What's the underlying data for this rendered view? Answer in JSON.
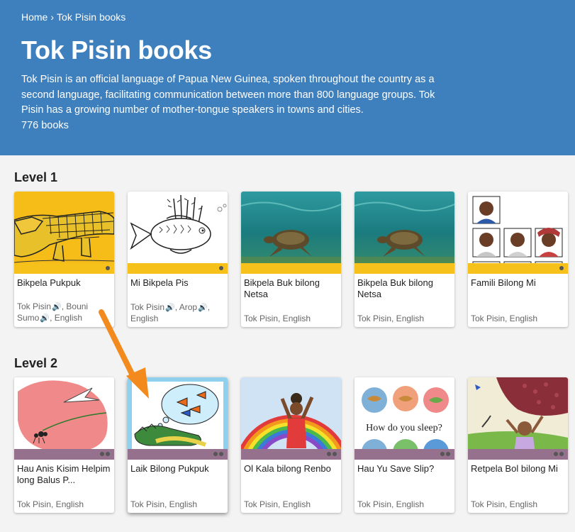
{
  "breadcrumb": {
    "home": "Home",
    "separator": "›",
    "current": "Tok Pisin books"
  },
  "header": {
    "title": "Tok Pisin books",
    "description": "Tok Pisin is an official language of Papua New Guinea, spoken throughout the country as a second language, facilitating communication between more than 800 language groups. Tok Pisin has a growing number of mother-tongue speakers in towns and cities.",
    "count": "776 books"
  },
  "levels": [
    {
      "heading": "Level 1",
      "books": [
        {
          "title": "Bikpela Pukpuk",
          "langs_a": "Tok Pisin",
          "langs_b": ", Bouni Sumo",
          "langs_c": ", English"
        },
        {
          "title": "Mi Bikpela Pis",
          "langs_a": "Tok Pisin",
          "langs_b": ", Arop",
          "langs_c": ", English"
        },
        {
          "title": "Bikpela Buk bilong Netsa",
          "langs": "Tok Pisin, English"
        },
        {
          "title": "Bikpela Buk bilong Netsa",
          "langs": "Tok Pisin, English"
        },
        {
          "title": "Famili Bilong Mi",
          "langs": "Tok Pisin, English"
        }
      ]
    },
    {
      "heading": "Level 2",
      "books": [
        {
          "title": "Hau Anis Kisim Helpim long Balus P...",
          "langs": "Tok Pisin, English"
        },
        {
          "title": "Laik Bilong Pukpuk",
          "langs": "Tok Pisin, English"
        },
        {
          "title": "Ol Kala bilong Renbo",
          "langs": "Tok Pisin, English"
        },
        {
          "title": "Hau Yu Save Slip?",
          "langs": "Tok Pisin, English",
          "cover_text": "How do you sleep?"
        },
        {
          "title": "Retpela Bol bilong Mi",
          "langs": "Tok Pisin, English"
        }
      ]
    }
  ],
  "colors": {
    "header": "#3e7fbd",
    "level1_band": "#f7c11c",
    "level2_band": "#95718e",
    "arrow": "#f28a1e",
    "speaker": "#2a8fa8"
  },
  "icons": {
    "speaker": "🔊"
  }
}
